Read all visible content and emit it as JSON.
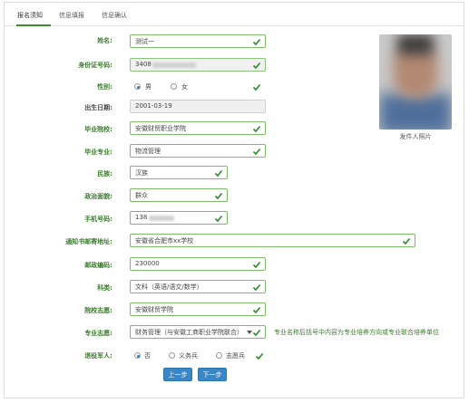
{
  "tabs": [
    {
      "label": "报名须知"
    },
    {
      "label": "信息填报"
    },
    {
      "label": "信息确认"
    }
  ],
  "form": {
    "name_label": "姓名:",
    "name_value": "测试一",
    "id_label": "身份证号码:",
    "id_value": "3408",
    "gender_label": "性别:",
    "gender_options": [
      "男",
      "女"
    ],
    "gender_selected": "男",
    "birth_label": "出生日期:",
    "birth_value": "2001-03-19",
    "school_label": "毕业院校:",
    "school_value": "安徽财贸职业学院",
    "major_label": "毕业专业:",
    "major_value": "物流管理",
    "ethnic_label": "民族:",
    "ethnic_value": "汉族",
    "political_label": "政治面貌:",
    "political_value": "群众",
    "phone_label": "手机号码:",
    "phone_value": "138",
    "address_label": "通知书邮寄地址:",
    "address_value": "安徽省合肥市xx学校",
    "postcode_label": "邮政编码:",
    "postcode_value": "230000",
    "category_label": "科类:",
    "category_value": "文科（英语/语文/数学）",
    "college_label": "院校志愿:",
    "college_value": "安徽财贸学院",
    "major_choice_label": "专业志愿:",
    "major_choice_value": "财务管理（与安徽工商职业学院联合）",
    "major_hint": "专业名称后括号中内容为专业培养方向或专业联合培养单位",
    "veteran_label": "退役军人:",
    "veteran_options": [
      "否",
      "义务兵",
      "志愿兵"
    ],
    "veteran_selected": "否"
  },
  "photo": {
    "caption": "发件人照片"
  },
  "buttons": {
    "prev": "上一步",
    "next": "下一步"
  },
  "colors": {
    "label_green": "#3a7c2c",
    "field_border": "#6fb25a",
    "check_green": "#2e8b2e",
    "button_blue": "#3a87c8"
  }
}
